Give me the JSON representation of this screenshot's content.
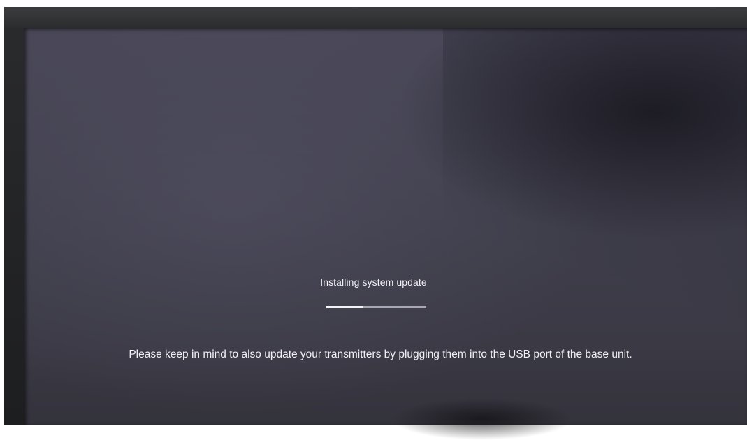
{
  "update_screen": {
    "status_text": "Installing system update",
    "progress_fraction": 0.37,
    "notice": "Please keep in mind to also update your transmitters by plugging them into the USB port of the base unit."
  },
  "colors": {
    "screen_background": "#403f4c",
    "text": "#f2f1f6",
    "progress_fill": "#f4f3f8",
    "progress_track": "#a9a7b2"
  }
}
